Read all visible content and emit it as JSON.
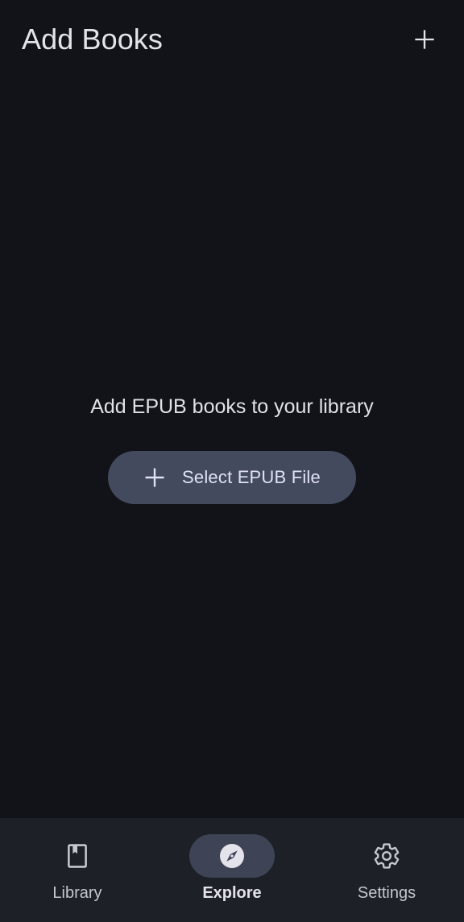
{
  "header": {
    "title": "Add Books",
    "add_icon": "plus-icon"
  },
  "empty_state": {
    "message": "Add EPUB books to your library",
    "button": {
      "label": "Select EPUB File",
      "icon": "plus-icon"
    }
  },
  "bottom_nav": {
    "items": [
      {
        "label": "Library",
        "icon": "book-icon",
        "active": false
      },
      {
        "label": "Explore",
        "icon": "compass-icon",
        "active": true
      },
      {
        "label": "Settings",
        "icon": "gear-icon",
        "active": false
      }
    ]
  },
  "colors": {
    "background": "#121318",
    "button_background": "#444a5e",
    "nav_background": "#1d2027",
    "nav_active_indicator": "#3e4456"
  }
}
